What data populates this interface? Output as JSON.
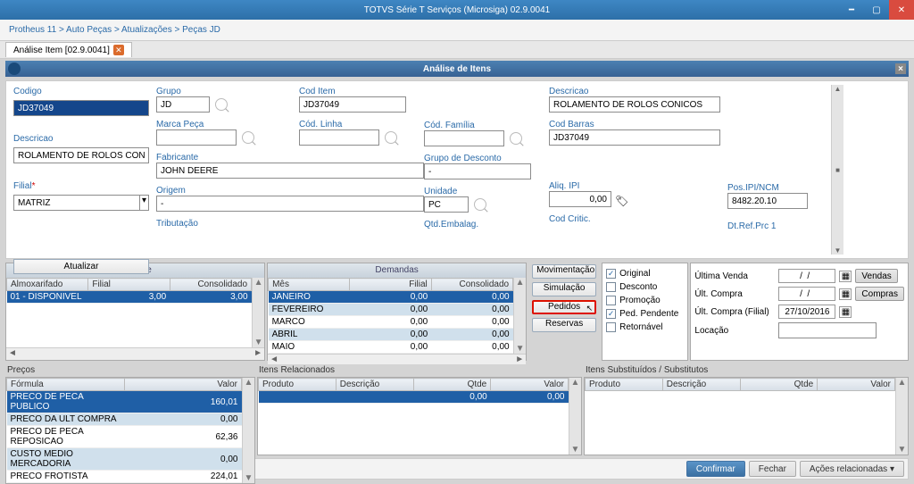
{
  "window": {
    "title": "TOTVS Série T Serviços (Microsiga) 02.9.0041"
  },
  "breadcrumb": "Protheus 11 > Auto Peças > Atualizações > Peças JD",
  "tab": {
    "label": "Análise Item [02.9.0041]"
  },
  "modal_title": "Análise de Itens",
  "form": {
    "codigo": {
      "label": "Codigo",
      "value": "JD37049"
    },
    "descricao_short": {
      "label": "Descricao",
      "value": "ROLAMENTO DE ROLOS CON"
    },
    "filial": {
      "label": "Filial",
      "value": "MATRIZ"
    },
    "grupo": {
      "label": "Grupo",
      "value": "JD"
    },
    "marca": {
      "label": "Marca Peça",
      "value": ""
    },
    "fabricante": {
      "label": "Fabricante",
      "value": "JOHN DEERE"
    },
    "origem": {
      "label": "Origem",
      "value": "-"
    },
    "tributacao": {
      "label": "Tributação",
      "value": ""
    },
    "coditem": {
      "label": "Cod Item",
      "value": "JD37049"
    },
    "codlinha": {
      "label": "Cód. Linha",
      "value": ""
    },
    "codfamilia": {
      "label": "Cód. Família",
      "value": ""
    },
    "grupodesc": {
      "label": "Grupo de Desconto",
      "value": "-"
    },
    "unidade": {
      "label": "Unidade",
      "value": "PC"
    },
    "qtdemb": {
      "label": "Qtd.Embalag.",
      "value": ""
    },
    "descricao_long": {
      "label": "Descricao",
      "value": "ROLAMENTO DE ROLOS CONICOS"
    },
    "codbarras": {
      "label": "Cod Barras",
      "value": "JD37049"
    },
    "aliqipi": {
      "label": "Aliq. IPI",
      "value": "0,00"
    },
    "posipincm": {
      "label": "Pos.IPI/NCM",
      "value": "8482.20.10"
    },
    "codcritic": {
      "label": "Cod Critic.",
      "value": ""
    },
    "dtref": {
      "label": "Dt.Ref.Prc 1",
      "value": ""
    },
    "btn_atualizar": "Atualizar"
  },
  "stock": {
    "header": "Estoque",
    "cols": [
      "Almoxarifado",
      "Filial",
      "Consolidado"
    ],
    "rows": [
      [
        "01 - DISPONIVEL",
        "3,00",
        "3,00"
      ]
    ]
  },
  "demand": {
    "header": "Demandas",
    "cols": [
      "Mês",
      "Filial",
      "Consolidado"
    ],
    "rows": [
      [
        "JANEIRO",
        "0,00",
        "0,00"
      ],
      [
        "FEVEREIRO",
        "0,00",
        "0,00"
      ],
      [
        "MARCO",
        "0,00",
        "0,00"
      ],
      [
        "ABRIL",
        "0,00",
        "0,00"
      ],
      [
        "MAIO",
        "0,00",
        "0,00"
      ]
    ]
  },
  "sidebtns": {
    "movimentacao": "Movimentação",
    "simulacao": "Simulação",
    "pedidos": "Pedidos",
    "reservas": "Reservas"
  },
  "checks": {
    "original": {
      "label": "Original",
      "checked": true
    },
    "desconto": {
      "label": "Desconto",
      "checked": false
    },
    "promocao": {
      "label": "Promoção",
      "checked": false
    },
    "pedpend": {
      "label": "Ped. Pendente",
      "checked": true
    },
    "retorn": {
      "label": "Retornável",
      "checked": false
    }
  },
  "info": {
    "ultvenda": {
      "label": "Última Venda",
      "value": "  /  /    "
    },
    "ultcompra": {
      "label": "Últ. Compra",
      "value": "  /  /    "
    },
    "ultcompraf": {
      "label": "Últ. Compra (Filial)",
      "value": "27/10/2016"
    },
    "locacao": {
      "label": "Locação",
      "value": ""
    },
    "btn_vendas": "Vendas",
    "btn_compras": "Compras"
  },
  "precos": {
    "label": "Preços",
    "cols": [
      "Fórmula",
      "Valor"
    ],
    "rows": [
      [
        "PRECO DE PECA PUBLICO",
        "160,01"
      ],
      [
        "PRECO DA ULT COMPRA",
        "0,00"
      ],
      [
        "PRECO DE PECA REPOSICAO",
        "62,36"
      ],
      [
        "CUSTO MEDIO MERCADORIA",
        "0,00"
      ],
      [
        "PRECO FROTISTA",
        "224,01"
      ]
    ]
  },
  "relac": {
    "label": "Itens Relacionados",
    "cols": [
      "Produto",
      "Descrição",
      "Qtde",
      "Valor"
    ],
    "rows": [
      [
        "",
        "",
        "0,00",
        "0,00"
      ]
    ]
  },
  "subst": {
    "label": "Itens Substituídos / Substitutos",
    "cols": [
      "Produto",
      "Descrição",
      "Qtde",
      "Valor"
    ],
    "rows": []
  },
  "footer": {
    "confirmar": "Confirmar",
    "fechar": "Fechar",
    "acoes": "Ações relacionadas"
  }
}
